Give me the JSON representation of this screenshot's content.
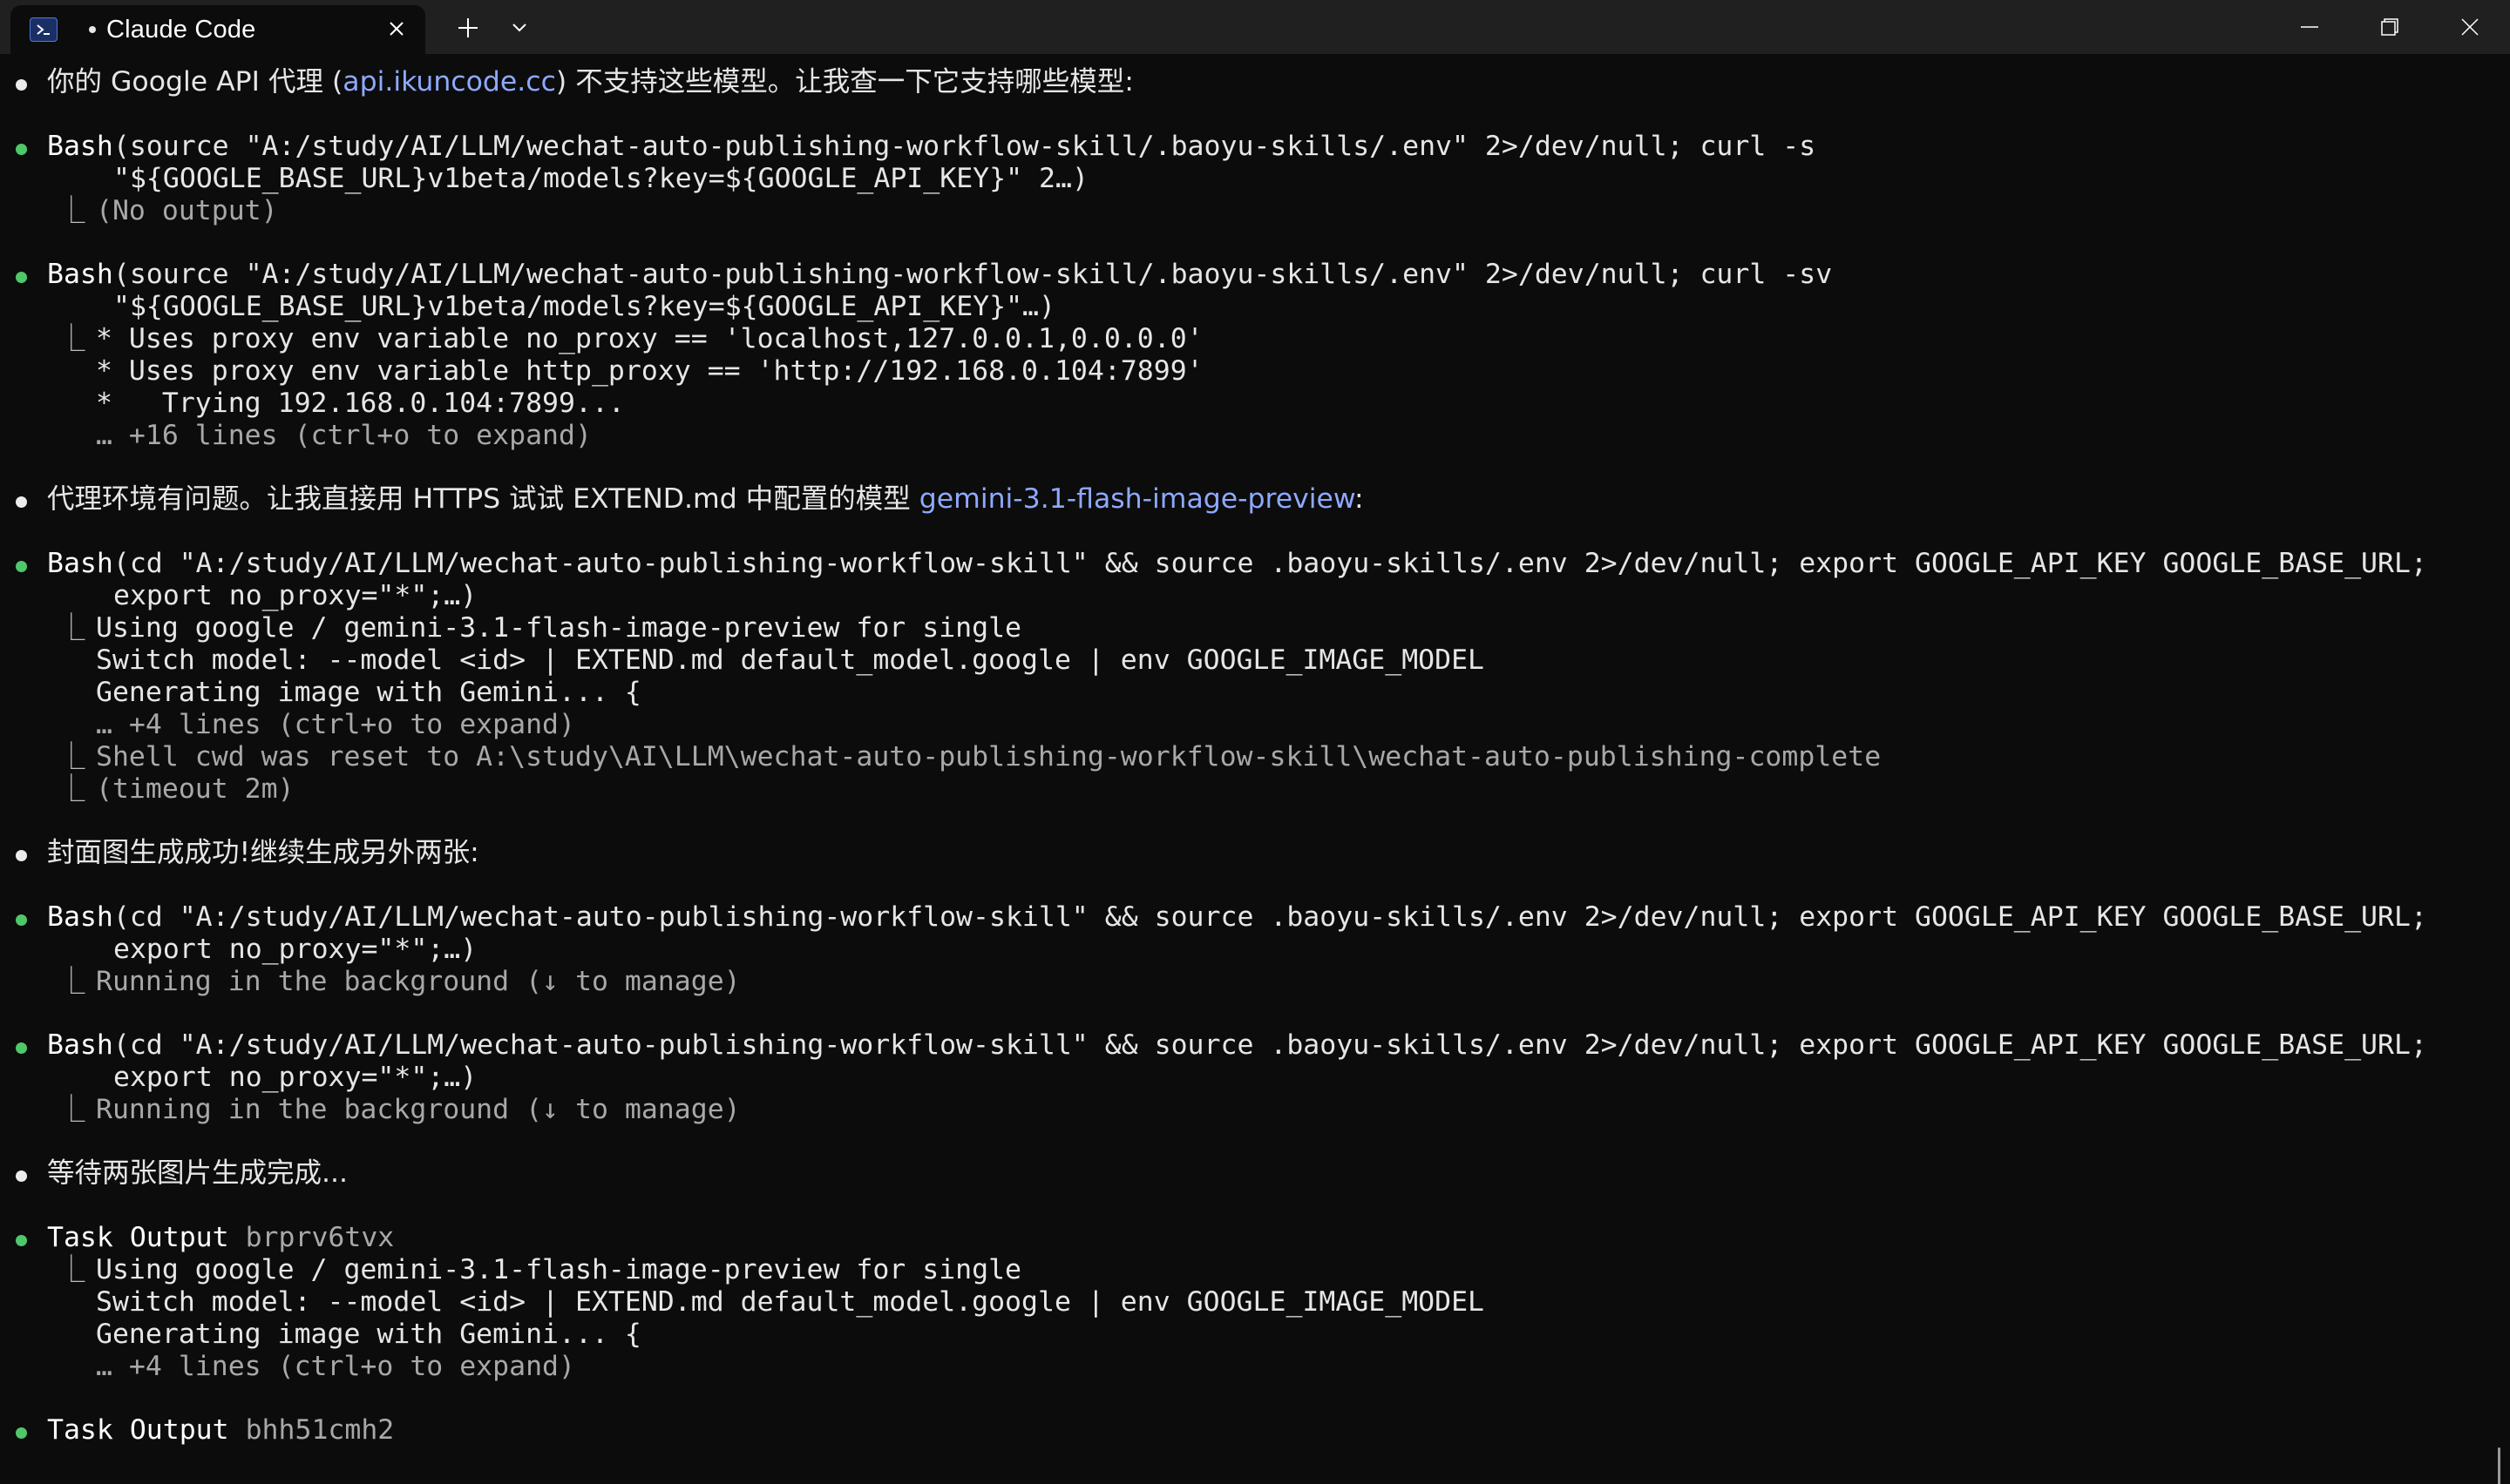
{
  "window": {
    "tab_title": "Claude Code",
    "tab_icon": "powershell-icon",
    "new_tab_icon": "plus-icon",
    "dropdown_icon": "chevron-down-icon",
    "controls": [
      "minimize-icon",
      "maximize-icon",
      "close-icon"
    ]
  },
  "colors": {
    "background": "#0c0c0c",
    "titlebar": "#202020",
    "bullet_green": "#4ec86a",
    "link_blue": "#8ea9ff",
    "dim_text": "#a8a8a8"
  },
  "terminal": {
    "msg1": {
      "pre": "你的 Google API 代理 (",
      "link": "api.ikuncode.cc",
      "post": ") 不支持这些模型。让我查一下它支持哪些模型:"
    },
    "bash1": {
      "name": "Bash",
      "line1": "(source \"A:/study/AI/LLM/wechat-auto-publishing-workflow-skill/.baoyu-skills/.env\" 2>/dev/null; curl -s",
      "line2": "\"${GOOGLE_BASE_URL}v1beta/models?key=${GOOGLE_API_KEY}\" 2…)",
      "out1": "(No output)"
    },
    "bash2": {
      "name": "Bash",
      "line1": "(source \"A:/study/AI/LLM/wechat-auto-publishing-workflow-skill/.baoyu-skills/.env\" 2>/dev/null; curl -sv",
      "line2": "\"${GOOGLE_BASE_URL}v1beta/models?key=${GOOGLE_API_KEY}\"…)",
      "out1": "* Uses proxy env variable no_proxy == 'localhost,127.0.0.1,0.0.0.0'",
      "out2": "* Uses proxy env variable http_proxy == 'http://192.168.0.104:7899'",
      "out3": "*   Trying 192.168.0.104:7899...",
      "more": "… +16 lines (ctrl+o to expand)"
    },
    "msg2": {
      "pre": "代理环境有问题。让我直接用 HTTPS 试试 EXTEND.md 中配置的模型 ",
      "link": "gemini-3.1-flash-image-preview",
      "post": ":"
    },
    "bash3": {
      "name": "Bash",
      "line1": "(cd \"A:/study/AI/LLM/wechat-auto-publishing-workflow-skill\" && source .baoyu-skills/.env 2>/dev/null; export GOOGLE_API_KEY GOOGLE_BASE_URL;",
      "line2": "export no_proxy=\"*\";…)",
      "out1": "Using google / gemini-3.1-flash-image-preview for single",
      "out2": "Switch model: --model <id> | EXTEND.md default_model.google | env GOOGLE_IMAGE_MODEL",
      "out3": "Generating image with Gemini... {",
      "more": "… +4 lines (ctrl+o to expand)",
      "cwd": "Shell cwd was reset to A:\\study\\AI\\LLM\\wechat-auto-publishing-workflow-skill\\wechat-auto-publishing-complete",
      "timeout": "(timeout 2m)"
    },
    "msg3": {
      "text": "封面图生成成功!继续生成另外两张:"
    },
    "bash4": {
      "name": "Bash",
      "line1": "(cd \"A:/study/AI/LLM/wechat-auto-publishing-workflow-skill\" && source .baoyu-skills/.env 2>/dev/null; export GOOGLE_API_KEY GOOGLE_BASE_URL;",
      "line2": "export no_proxy=\"*\";…)",
      "out1": "Running in the background (↓ to manage)"
    },
    "bash5": {
      "name": "Bash",
      "line1": "(cd \"A:/study/AI/LLM/wechat-auto-publishing-workflow-skill\" && source .baoyu-skills/.env 2>/dev/null; export GOOGLE_API_KEY GOOGLE_BASE_URL;",
      "line2": "export no_proxy=\"*\";…)",
      "out1": "Running in the background (↓ to manage)"
    },
    "msg4": {
      "text": "等待两张图片生成完成..."
    },
    "task1": {
      "name": "Task Output",
      "id": "brprv6tvx",
      "out1": "Using google / gemini-3.1-flash-image-preview for single",
      "out2": "Switch model: --model <id> | EXTEND.md default_model.google | env GOOGLE_IMAGE_MODEL",
      "out3": "Generating image with Gemini... {",
      "more": "… +4 lines (ctrl+o to expand)"
    },
    "task2": {
      "name": "Task Output",
      "id": "bhh51cmh2"
    },
    "branch_glyph": "⎿"
  }
}
